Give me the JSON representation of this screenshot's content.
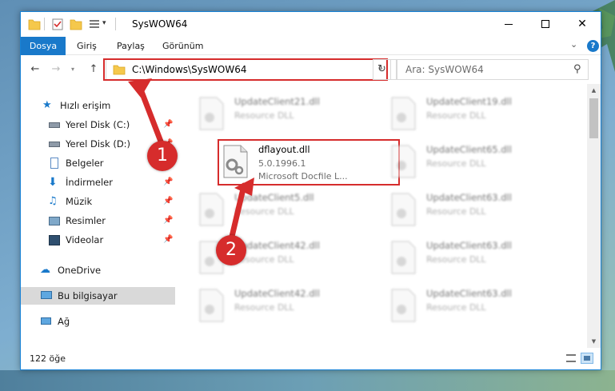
{
  "window": {
    "title": "SysWOW64"
  },
  "ribbon": {
    "tabs": [
      "Dosya",
      "Giriş",
      "Paylaş",
      "Görünüm"
    ]
  },
  "address": {
    "path": "C:\\Windows\\SysWOW64"
  },
  "search": {
    "placeholder": "Ara: SysWOW64"
  },
  "sidebar": {
    "items": [
      {
        "label": "Hızlı erişim",
        "icon": "star-icon"
      },
      {
        "label": "Yerel Disk (C:)",
        "icon": "drive-icon",
        "pinned": true
      },
      {
        "label": "Yerel Disk (D:)",
        "icon": "drive-icon",
        "pinned": true
      },
      {
        "label": "Belgeler",
        "icon": "documents-icon",
        "pinned": true
      },
      {
        "label": "İndirmeler",
        "icon": "downloads-icon",
        "pinned": true
      },
      {
        "label": "Müzik",
        "icon": "music-icon",
        "pinned": true
      },
      {
        "label": "Resimler",
        "icon": "pictures-icon",
        "pinned": true
      },
      {
        "label": "Videolar",
        "icon": "videos-icon",
        "pinned": true
      },
      {
        "label": "OneDrive",
        "icon": "cloud-icon"
      },
      {
        "label": "Bu bilgisayar",
        "icon": "computer-icon"
      },
      {
        "label": "Ağ",
        "icon": "network-icon"
      }
    ]
  },
  "files": {
    "highlighted": {
      "name": "dflayout.dll",
      "version": "5.0.1996.1",
      "description": "Microsoft Docfile L..."
    },
    "others": [
      {
        "name": "UpdateClient21.dll",
        "type": "Resource DLL"
      },
      {
        "name": "UpdateClient19.dll",
        "type": "Resource DLL"
      },
      {
        "name": "UpdateClient65.dll",
        "type": "Resource DLL"
      },
      {
        "name": "UpdateClient5.dll",
        "type": "Resource DLL"
      },
      {
        "name": "UpdateClient63.dll",
        "type": "Resource DLL"
      },
      {
        "name": "UpdateClient42.dll",
        "type": "Resource DLL"
      },
      {
        "name": "UpdateClient63.dll",
        "type": "Resource DLL"
      },
      {
        "name": "UpdateClient42.dll",
        "type": "Resource DLL"
      },
      {
        "name": "UpdateClient63.dll",
        "type": "Resource DLL"
      }
    ]
  },
  "status": {
    "count": "122 öğe"
  },
  "annotations": {
    "step1": "1",
    "step2": "2"
  },
  "colors": {
    "accent": "#1979ca",
    "highlight": "#d62c2c",
    "selected": "#d9d9d9"
  }
}
